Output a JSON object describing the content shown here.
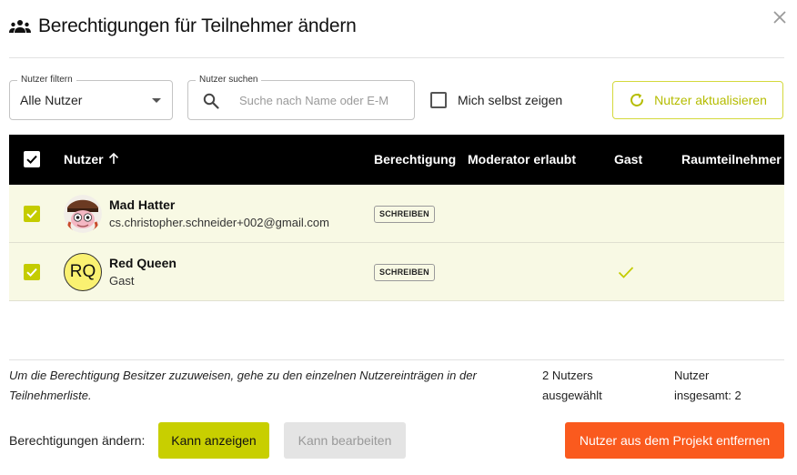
{
  "dialog": {
    "title": "Berechtigungen für Teilnehmer ändern"
  },
  "filters": {
    "filter_label": "Nutzer filtern",
    "filter_value": "Alle Nutzer",
    "search_label": "Nutzer suchen",
    "search_placeholder": "Suche nach Name oder E-M",
    "search_value": "",
    "self_show_label": "Mich selbst zeigen",
    "self_show_checked": false,
    "refresh_label": "Nutzer aktualisieren"
  },
  "table": {
    "columns": {
      "user": "Nutzer",
      "permission": "Berechtigung",
      "moderator": "Moderator erlaubt",
      "guest": "Gast",
      "room": "Raumteilnehmer"
    },
    "rows": [
      {
        "name": "Mad Hatter",
        "subtitle": "cs.christopher.schneider+002@gmail.com",
        "permission": "SCHREIBEN",
        "guest": false,
        "selected": true
      },
      {
        "name": "Red Queen",
        "subtitle": "Gast",
        "initials": "RQ",
        "permission": "SCHREIBEN",
        "guest": true,
        "selected": true
      }
    ]
  },
  "footer": {
    "hint": "Um die Berechtigung Besitzer zuzuweisen, gehe zu den einzelnen Nutzereinträgen in der Teilnehmerliste.",
    "selected_line1": "2 Nutzers",
    "selected_line2": "ausgewählt",
    "total_line1": "Nutzer",
    "total_line2": "insgesamt: 2",
    "permissions_label": "Berechtigungen ändern:",
    "view_button": "Kann anzeigen",
    "edit_button": "Kann bearbeiten",
    "remove_button": "Nutzer aus dem Projekt entfernen"
  },
  "colors": {
    "accent": "#c8cf00",
    "danger": "#fa5a1e",
    "selected_row": "#f8f9e4",
    "header": "#000000"
  }
}
